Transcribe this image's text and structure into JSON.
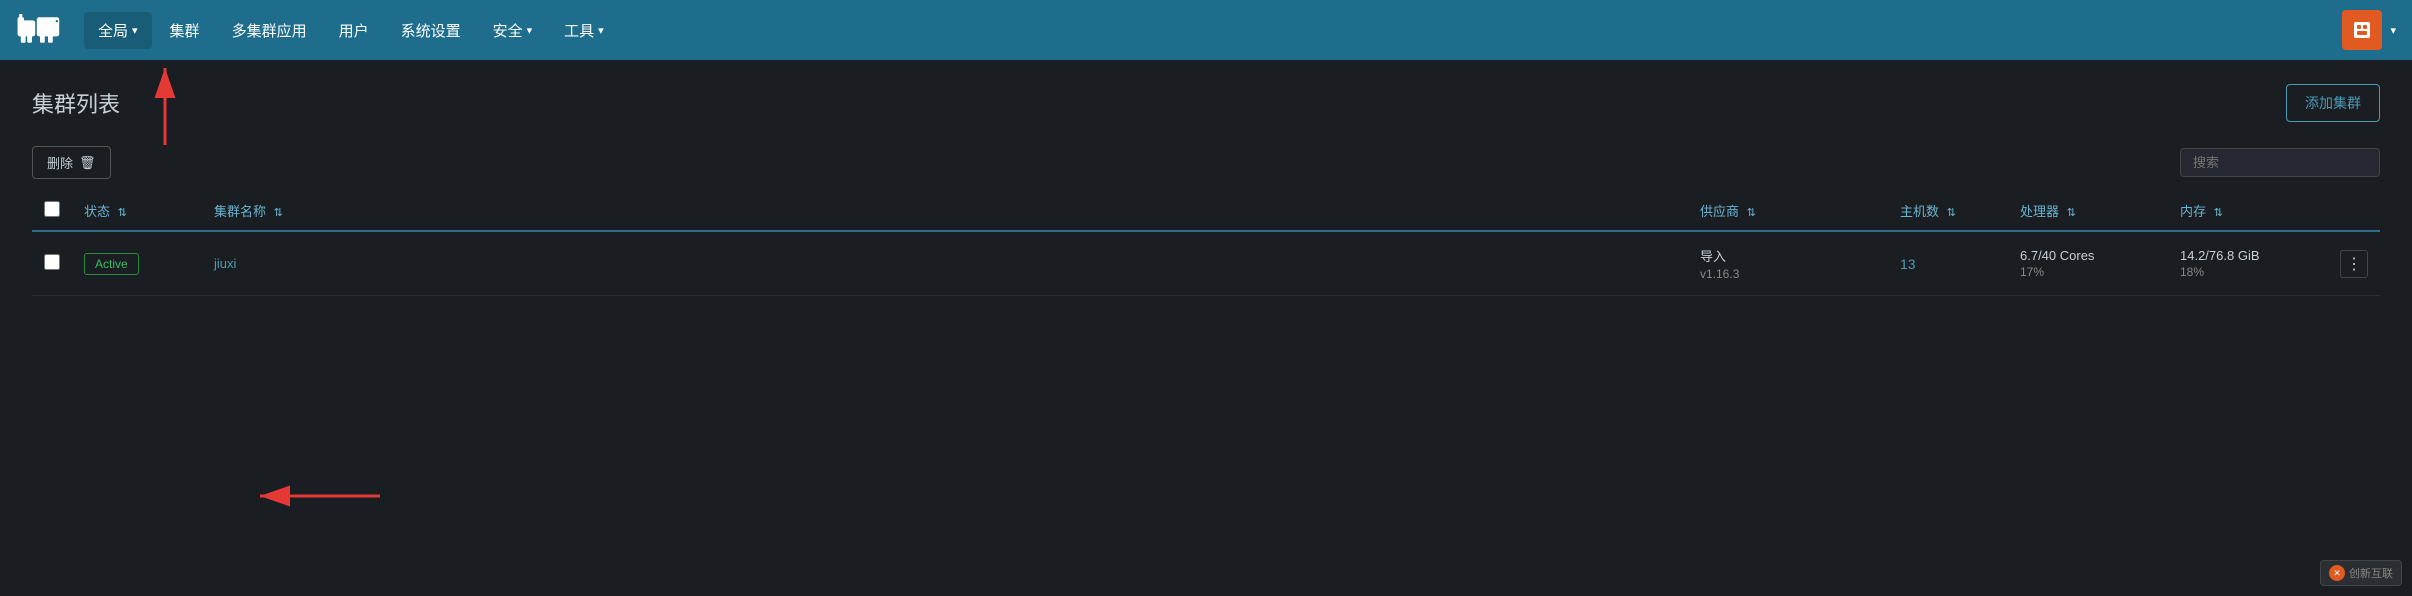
{
  "navbar": {
    "items": [
      {
        "id": "global",
        "label": "全局",
        "hasDropdown": true,
        "active": true
      },
      {
        "id": "cluster",
        "label": "集群",
        "hasDropdown": false
      },
      {
        "id": "multi-cluster-apps",
        "label": "多集群应用",
        "hasDropdown": false
      },
      {
        "id": "users",
        "label": "用户",
        "hasDropdown": false
      },
      {
        "id": "system-settings",
        "label": "系统设置",
        "hasDropdown": false
      },
      {
        "id": "security",
        "label": "安全",
        "hasDropdown": true
      },
      {
        "id": "tools",
        "label": "工具",
        "hasDropdown": true
      }
    ]
  },
  "page": {
    "title": "集群列表",
    "add_button": "添加集群"
  },
  "toolbar": {
    "delete_button": "删除",
    "search_placeholder": "搜索"
  },
  "table": {
    "columns": [
      {
        "id": "status",
        "label": "状态",
        "sortable": true
      },
      {
        "id": "name",
        "label": "集群名称",
        "sortable": true
      },
      {
        "id": "vendor",
        "label": "供应商",
        "sortable": true
      },
      {
        "id": "hosts",
        "label": "主机数",
        "sortable": true
      },
      {
        "id": "cpu",
        "label": "处理器",
        "sortable": true
      },
      {
        "id": "memory",
        "label": "内存",
        "sortable": true
      }
    ],
    "rows": [
      {
        "id": "jiuxi-row",
        "status": "Active",
        "name": "jiuxi",
        "vendor_name": "导入",
        "vendor_version": "v1.16.3",
        "hosts": "13",
        "cpu_main": "6.7/40 Cores",
        "cpu_pct": "17%",
        "mem_main": "14.2/76.8 GiB",
        "mem_pct": "18%"
      }
    ]
  },
  "bottom_badge": {
    "icon": "✕",
    "text": "创新互联"
  }
}
